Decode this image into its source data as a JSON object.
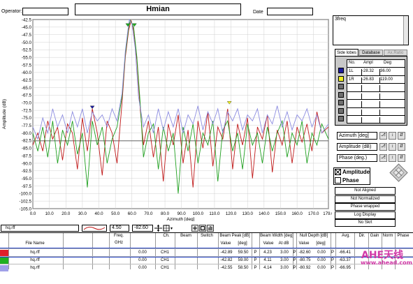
{
  "header": {
    "operator_label": "Operator:",
    "title": "Hmian",
    "date_label": "Date"
  },
  "notes_text": "3freq",
  "tabs": [
    {
      "label": "Side lobes",
      "active": true
    },
    {
      "label": "Database",
      "active": false
    },
    {
      "label": "Ax.Ratio",
      "active": false
    }
  ],
  "sidelobes_table": {
    "headers": [
      "No.",
      "Ampl",
      "Deg"
    ],
    "rows": [
      {
        "color": "#1e1e9e",
        "no": "1L",
        "ampl": "-28.32",
        "deg": "36.00"
      },
      {
        "color": "#f0f020",
        "no": "1R",
        "ampl": "-26.83",
        "deg": "119.00"
      },
      {
        "color": "#707070",
        "no": "",
        "ampl": "",
        "deg": ""
      },
      {
        "color": "#707070",
        "no": "",
        "ampl": "",
        "deg": ""
      },
      {
        "color": "#707070",
        "no": "",
        "ampl": "",
        "deg": ""
      },
      {
        "color": "#707070",
        "no": "",
        "ampl": "",
        "deg": ""
      },
      {
        "color": "#707070",
        "no": "",
        "ampl": "",
        "deg": ""
      }
    ]
  },
  "axis_controls": [
    {
      "label": "Azimuth  [deg]"
    },
    {
      "label": "Amplitude (dB)"
    },
    {
      "label": "Phase (deg.)"
    }
  ],
  "display_options": {
    "amplitude_label": "Amplitude",
    "amplitude_checked": true,
    "phase_label": "Phase",
    "phase_checked": false
  },
  "side_buttons": [
    "Not Aligned",
    "Not Normalized",
    "Phase wrapped",
    "Log Display",
    "No Skrt"
  ],
  "toolbar": {
    "file": "hq.rff",
    "value1": "4.50",
    "value2": "-82.60"
  },
  "results_table": {
    "col_groups": [
      "Freq.",
      "Ch.",
      "Beam",
      "Switch",
      "Beam Peak [dB]",
      "Beam Width [deg]",
      "Null Depth [dB]",
      "Avg.",
      "Dir.",
      "Gain",
      "Norm",
      "Phase"
    ],
    "sub_headers": [
      "File Name",
      "GHz",
      "Value",
      "[deg]",
      "Value",
      "At dB",
      "Value",
      "[deg]"
    ],
    "rows": [
      {
        "color": "#e0202a",
        "file": "hq.rff",
        "freq": "0.00",
        "ch": "CH1",
        "peak": "-42.89",
        "peak_deg": "59.50",
        "p1": "P",
        "bw": "4.23",
        "at": "3.00",
        "p2": "P",
        "null": "-82.60",
        "null_deg": "0.00",
        "p3": "P",
        "avg": "-66.41"
      },
      {
        "color": "#20b020",
        "file": "hq.rff",
        "freq": "0.00",
        "ch": "CH1",
        "peak": "-42.82",
        "peak_deg": "59.00",
        "p1": "P",
        "bw": "4.11",
        "at": "3.00",
        "p2": "P",
        "null": "-80.75",
        "null_deg": "0.00",
        "p3": "P",
        "avg": "-63.37"
      },
      {
        "color": "#a0a0e8",
        "file": "hq.rff",
        "freq": "0.00",
        "ch": "CH1",
        "peak": "-42.55",
        "peak_deg": "58.50",
        "p1": "P",
        "bw": "4.14",
        "at": "3.00",
        "p2": "P",
        "null": "-80.92",
        "null_deg": "0.00",
        "p3": "P",
        "avg": "-66.95"
      }
    ]
  },
  "watermark": {
    "line1": "AHE天线",
    "line2": "www.ahead.com"
  },
  "chart_data": {
    "type": "line",
    "xlabel": "Azimuth  [deg]",
    "ylabel": "Amplitude (dB)",
    "xlim": [
      0,
      179
    ],
    "ylim": [
      -105,
      -42.5
    ],
    "x_ticks": [
      "0.0",
      "10.0",
      "20.0",
      "30.0",
      "40.0",
      "50.0",
      "60.0",
      "70.0",
      "80.0",
      "90.0",
      "100.0",
      "110.0",
      "120.0",
      "130.0",
      "140.0",
      "150.0",
      "160.0",
      "170.0",
      "179.0"
    ],
    "y_ticks": [
      "-42.5",
      "-45.0",
      "-47.5",
      "-50.0",
      "-52.5",
      "-55.0",
      "-57.5",
      "-60.0",
      "-62.5",
      "-65.0",
      "-67.5",
      "-70.0",
      "-72.5",
      "-75.0",
      "-77.5",
      "-80.0",
      "-82.5",
      "-85.0",
      "-87.5",
      "-90.0",
      "-92.5",
      "-95.0",
      "-97.5",
      "-100.0",
      "-102.5",
      "-105.0"
    ],
    "grid": true,
    "reference_line": -82.6,
    "markers": [
      {
        "x": 36,
        "y": -71.5,
        "color": "#1e1e9e"
      },
      {
        "x": 119,
        "y": -70.0,
        "color": "#f0f020"
      },
      {
        "x": 57.5,
        "y": -44.3,
        "color": "#20b020"
      },
      {
        "x": 61.5,
        "y": -44.3,
        "color": "#20b020"
      }
    ],
    "series": [
      {
        "color": "#c01818",
        "values": [
          [
            0,
            -84
          ],
          [
            3,
            -80
          ],
          [
            6,
            -86
          ],
          [
            9,
            -76
          ],
          [
            12,
            -82
          ],
          [
            15,
            -78
          ],
          [
            18,
            -89
          ],
          [
            21,
            -77
          ],
          [
            24,
            -80
          ],
          [
            27,
            -92
          ],
          [
            30,
            -75
          ],
          [
            33,
            -86
          ],
          [
            36,
            -72
          ],
          [
            39,
            -80
          ],
          [
            42,
            -94
          ],
          [
            45,
            -76
          ],
          [
            48,
            -80
          ],
          [
            51,
            -90
          ],
          [
            54,
            -70
          ],
          [
            56,
            -55
          ],
          [
            58,
            -46
          ],
          [
            59.5,
            -42.9
          ],
          [
            61,
            -46
          ],
          [
            63,
            -56
          ],
          [
            65,
            -72
          ],
          [
            67,
            -84
          ],
          [
            70,
            -76
          ],
          [
            73,
            -88
          ],
          [
            76,
            -78
          ],
          [
            79,
            -96
          ],
          [
            82,
            -77
          ],
          [
            85,
            -84
          ],
          [
            88,
            -74
          ],
          [
            91,
            -90
          ],
          [
            94,
            -79
          ],
          [
            97,
            -98
          ],
          [
            100,
            -76
          ],
          [
            103,
            -85
          ],
          [
            106,
            -73
          ],
          [
            109,
            -91
          ],
          [
            112,
            -78
          ],
          [
            115,
            -82
          ],
          [
            118,
            -72
          ],
          [
            121,
            -92
          ],
          [
            124,
            -77
          ],
          [
            127,
            -84
          ],
          [
            130,
            -75
          ],
          [
            133,
            -95
          ],
          [
            136,
            -78
          ],
          [
            139,
            -82
          ],
          [
            142,
            -74
          ],
          [
            145,
            -93
          ],
          [
            148,
            -79
          ],
          [
            151,
            -84
          ],
          [
            154,
            -76
          ],
          [
            157,
            -90
          ],
          [
            160,
            -78
          ],
          [
            163,
            -83
          ],
          [
            166,
            -77
          ],
          [
            169,
            -86
          ],
          [
            172,
            -73
          ],
          [
            175,
            -80
          ],
          [
            179,
            -78
          ]
        ]
      },
      {
        "color": "#20a020",
        "values": [
          [
            0,
            -80
          ],
          [
            3,
            -86
          ],
          [
            6,
            -78
          ],
          [
            9,
            -88
          ],
          [
            12,
            -76
          ],
          [
            15,
            -90
          ],
          [
            18,
            -79
          ],
          [
            21,
            -84
          ],
          [
            24,
            -76
          ],
          [
            27,
            -87
          ],
          [
            30,
            -80
          ],
          [
            33,
            -98
          ],
          [
            36,
            -76
          ],
          [
            39,
            -84
          ],
          [
            42,
            -78
          ],
          [
            45,
            -90
          ],
          [
            48,
            -82
          ],
          [
            51,
            -78
          ],
          [
            54,
            -68
          ],
          [
            56,
            -54
          ],
          [
            58,
            -45
          ],
          [
            59,
            -42.8
          ],
          [
            61,
            -45
          ],
          [
            63,
            -55
          ],
          [
            65,
            -70
          ],
          [
            67,
            -88
          ],
          [
            70,
            -80
          ],
          [
            73,
            -77
          ],
          [
            76,
            -92
          ],
          [
            79,
            -78
          ],
          [
            82,
            -86
          ],
          [
            85,
            -80
          ],
          [
            88,
            -100
          ],
          [
            91,
            -78
          ],
          [
            94,
            -86
          ],
          [
            97,
            -77
          ],
          [
            100,
            -90
          ],
          [
            103,
            -80
          ],
          [
            106,
            -84
          ],
          [
            109,
            -76
          ],
          [
            112,
            -96
          ],
          [
            115,
            -79
          ],
          [
            118,
            -76
          ],
          [
            121,
            -86
          ],
          [
            124,
            -80
          ],
          [
            127,
            -92
          ],
          [
            130,
            -77
          ],
          [
            133,
            -84
          ],
          [
            136,
            -80
          ],
          [
            139,
            -90
          ],
          [
            142,
            -78
          ],
          [
            145,
            -86
          ],
          [
            148,
            -80
          ],
          [
            151,
            -76
          ],
          [
            154,
            -88
          ],
          [
            157,
            -80
          ],
          [
            160,
            -84
          ],
          [
            163,
            -76
          ],
          [
            166,
            -90
          ],
          [
            169,
            -80
          ],
          [
            172,
            -84
          ],
          [
            175,
            -77
          ],
          [
            179,
            -82
          ]
        ]
      },
      {
        "color": "#8c8ce0",
        "values": [
          [
            0,
            -78
          ],
          [
            3,
            -82
          ],
          [
            6,
            -75
          ],
          [
            9,
            -80
          ],
          [
            12,
            -72
          ],
          [
            15,
            -78
          ],
          [
            18,
            -74
          ],
          [
            21,
            -80
          ],
          [
            24,
            -73
          ],
          [
            27,
            -78
          ],
          [
            30,
            -72
          ],
          [
            33,
            -80
          ],
          [
            36,
            -73
          ],
          [
            39,
            -76
          ],
          [
            42,
            -74
          ],
          [
            45,
            -78
          ],
          [
            48,
            -72
          ],
          [
            51,
            -76
          ],
          [
            54,
            -67
          ],
          [
            56,
            -53
          ],
          [
            58,
            -44
          ],
          [
            58.5,
            -42.55
          ],
          [
            60,
            -44
          ],
          [
            62,
            -52
          ],
          [
            64,
            -68
          ],
          [
            67,
            -78
          ],
          [
            70,
            -74
          ],
          [
            73,
            -80
          ],
          [
            76,
            -72
          ],
          [
            79,
            -79
          ],
          [
            82,
            -73
          ],
          [
            85,
            -78
          ],
          [
            88,
            -72
          ],
          [
            91,
            -80
          ],
          [
            94,
            -74
          ],
          [
            97,
            -77
          ],
          [
            100,
            -71
          ],
          [
            103,
            -79
          ],
          [
            106,
            -73
          ],
          [
            109,
            -77
          ],
          [
            112,
            -72
          ],
          [
            115,
            -80
          ],
          [
            118,
            -73
          ],
          [
            121,
            -76
          ],
          [
            124,
            -72
          ],
          [
            127,
            -79
          ],
          [
            130,
            -74
          ],
          [
            133,
            -76
          ],
          [
            136,
            -72
          ],
          [
            139,
            -80
          ],
          [
            142,
            -74
          ],
          [
            145,
            -77
          ],
          [
            148,
            -71
          ],
          [
            151,
            -78
          ],
          [
            154,
            -73
          ],
          [
            157,
            -79
          ],
          [
            160,
            -74
          ],
          [
            163,
            -76
          ],
          [
            166,
            -72
          ],
          [
            169,
            -78
          ],
          [
            172,
            -74
          ],
          [
            175,
            -80
          ],
          [
            179,
            -77
          ]
        ]
      }
    ]
  }
}
